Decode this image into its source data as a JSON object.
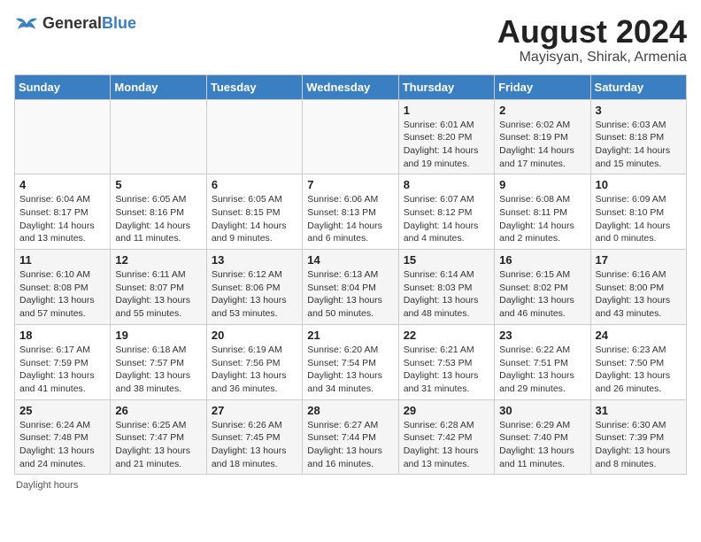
{
  "logo": {
    "general": "General",
    "blue": "Blue"
  },
  "title": "August 2024",
  "location": "Mayisyan, Shirak, Armenia",
  "days_of_week": [
    "Sunday",
    "Monday",
    "Tuesday",
    "Wednesday",
    "Thursday",
    "Friday",
    "Saturday"
  ],
  "weeks": [
    [
      {
        "day": "",
        "info": ""
      },
      {
        "day": "",
        "info": ""
      },
      {
        "day": "",
        "info": ""
      },
      {
        "day": "",
        "info": ""
      },
      {
        "day": "1",
        "info": "Sunrise: 6:01 AM\nSunset: 8:20 PM\nDaylight: 14 hours\nand 19 minutes."
      },
      {
        "day": "2",
        "info": "Sunrise: 6:02 AM\nSunset: 8:19 PM\nDaylight: 14 hours\nand 17 minutes."
      },
      {
        "day": "3",
        "info": "Sunrise: 6:03 AM\nSunset: 8:18 PM\nDaylight: 14 hours\nand 15 minutes."
      }
    ],
    [
      {
        "day": "4",
        "info": "Sunrise: 6:04 AM\nSunset: 8:17 PM\nDaylight: 14 hours\nand 13 minutes."
      },
      {
        "day": "5",
        "info": "Sunrise: 6:05 AM\nSunset: 8:16 PM\nDaylight: 14 hours\nand 11 minutes."
      },
      {
        "day": "6",
        "info": "Sunrise: 6:05 AM\nSunset: 8:15 PM\nDaylight: 14 hours\nand 9 minutes."
      },
      {
        "day": "7",
        "info": "Sunrise: 6:06 AM\nSunset: 8:13 PM\nDaylight: 14 hours\nand 6 minutes."
      },
      {
        "day": "8",
        "info": "Sunrise: 6:07 AM\nSunset: 8:12 PM\nDaylight: 14 hours\nand 4 minutes."
      },
      {
        "day": "9",
        "info": "Sunrise: 6:08 AM\nSunset: 8:11 PM\nDaylight: 14 hours\nand 2 minutes."
      },
      {
        "day": "10",
        "info": "Sunrise: 6:09 AM\nSunset: 8:10 PM\nDaylight: 14 hours\nand 0 minutes."
      }
    ],
    [
      {
        "day": "11",
        "info": "Sunrise: 6:10 AM\nSunset: 8:08 PM\nDaylight: 13 hours\nand 57 minutes."
      },
      {
        "day": "12",
        "info": "Sunrise: 6:11 AM\nSunset: 8:07 PM\nDaylight: 13 hours\nand 55 minutes."
      },
      {
        "day": "13",
        "info": "Sunrise: 6:12 AM\nSunset: 8:06 PM\nDaylight: 13 hours\nand 53 minutes."
      },
      {
        "day": "14",
        "info": "Sunrise: 6:13 AM\nSunset: 8:04 PM\nDaylight: 13 hours\nand 50 minutes."
      },
      {
        "day": "15",
        "info": "Sunrise: 6:14 AM\nSunset: 8:03 PM\nDaylight: 13 hours\nand 48 minutes."
      },
      {
        "day": "16",
        "info": "Sunrise: 6:15 AM\nSunset: 8:02 PM\nDaylight: 13 hours\nand 46 minutes."
      },
      {
        "day": "17",
        "info": "Sunrise: 6:16 AM\nSunset: 8:00 PM\nDaylight: 13 hours\nand 43 minutes."
      }
    ],
    [
      {
        "day": "18",
        "info": "Sunrise: 6:17 AM\nSunset: 7:59 PM\nDaylight: 13 hours\nand 41 minutes."
      },
      {
        "day": "19",
        "info": "Sunrise: 6:18 AM\nSunset: 7:57 PM\nDaylight: 13 hours\nand 38 minutes."
      },
      {
        "day": "20",
        "info": "Sunrise: 6:19 AM\nSunset: 7:56 PM\nDaylight: 13 hours\nand 36 minutes."
      },
      {
        "day": "21",
        "info": "Sunrise: 6:20 AM\nSunset: 7:54 PM\nDaylight: 13 hours\nand 34 minutes."
      },
      {
        "day": "22",
        "info": "Sunrise: 6:21 AM\nSunset: 7:53 PM\nDaylight: 13 hours\nand 31 minutes."
      },
      {
        "day": "23",
        "info": "Sunrise: 6:22 AM\nSunset: 7:51 PM\nDaylight: 13 hours\nand 29 minutes."
      },
      {
        "day": "24",
        "info": "Sunrise: 6:23 AM\nSunset: 7:50 PM\nDaylight: 13 hours\nand 26 minutes."
      }
    ],
    [
      {
        "day": "25",
        "info": "Sunrise: 6:24 AM\nSunset: 7:48 PM\nDaylight: 13 hours\nand 24 minutes."
      },
      {
        "day": "26",
        "info": "Sunrise: 6:25 AM\nSunset: 7:47 PM\nDaylight: 13 hours\nand 21 minutes."
      },
      {
        "day": "27",
        "info": "Sunrise: 6:26 AM\nSunset: 7:45 PM\nDaylight: 13 hours\nand 18 minutes."
      },
      {
        "day": "28",
        "info": "Sunrise: 6:27 AM\nSunset: 7:44 PM\nDaylight: 13 hours\nand 16 minutes."
      },
      {
        "day": "29",
        "info": "Sunrise: 6:28 AM\nSunset: 7:42 PM\nDaylight: 13 hours\nand 13 minutes."
      },
      {
        "day": "30",
        "info": "Sunrise: 6:29 AM\nSunset: 7:40 PM\nDaylight: 13 hours\nand 11 minutes."
      },
      {
        "day": "31",
        "info": "Sunrise: 6:30 AM\nSunset: 7:39 PM\nDaylight: 13 hours\nand 8 minutes."
      }
    ]
  ],
  "footer": "Daylight hours"
}
